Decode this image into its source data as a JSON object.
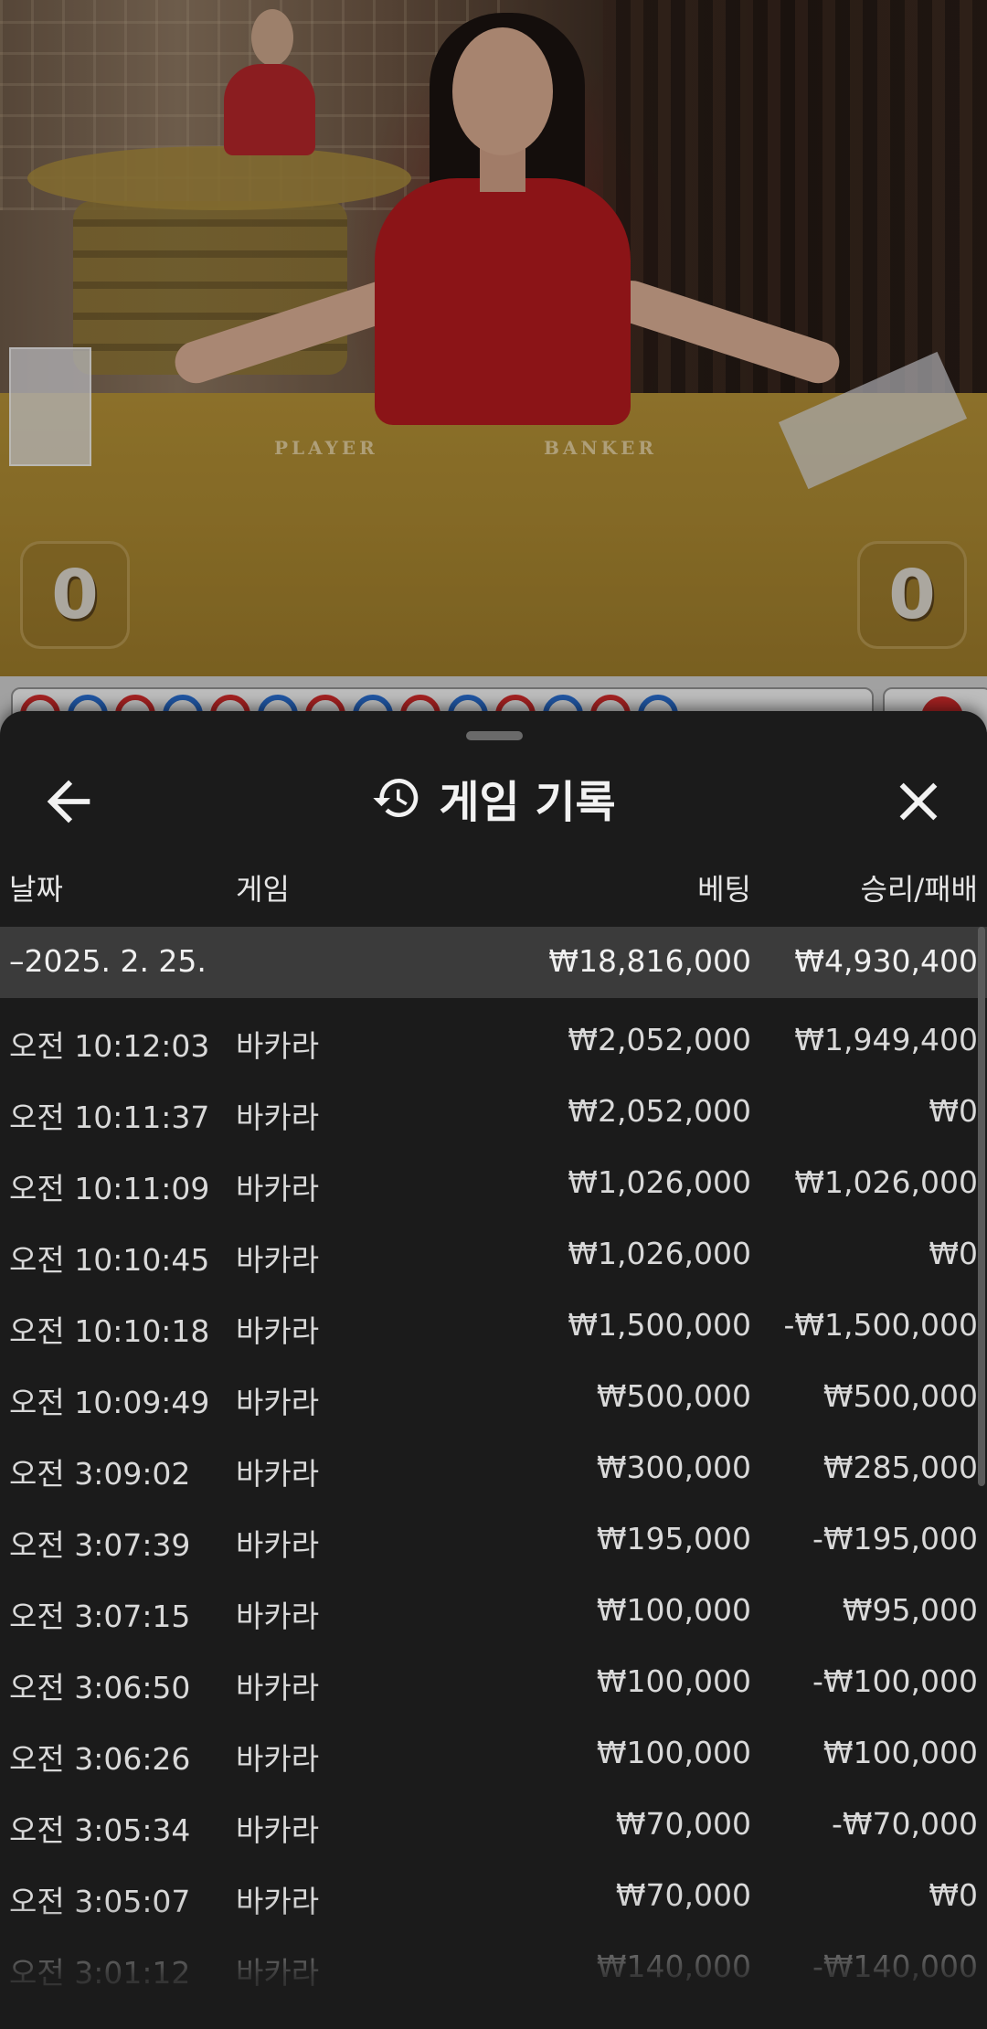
{
  "video": {
    "table_labels": {
      "player": "PLAYER",
      "banker": "BANKER"
    },
    "player_score": "0",
    "banker_score": "0",
    "roadmap": [
      "red",
      "blue",
      "red",
      "blue",
      "red",
      "blue",
      "red",
      "blue",
      "red",
      "blue",
      "red",
      "blue",
      "red",
      "blue"
    ]
  },
  "sheet": {
    "title": "게임 기록",
    "icons": {
      "back": "arrow-left-icon",
      "history": "history-icon",
      "close": "close-icon"
    },
    "columns": {
      "date": "날짜",
      "game": "게임",
      "bet": "베팅",
      "result": "승리/패배"
    },
    "date_group": {
      "date": "–2025. 2. 25.",
      "bet_total": "₩18,816,000",
      "result_total": "₩4,930,400"
    },
    "rows": [
      {
        "time": "오전 10:12:03",
        "game": "바카라",
        "bet": "₩2,052,000",
        "result": "₩1,949,400"
      },
      {
        "time": "오전 10:11:37",
        "game": "바카라",
        "bet": "₩2,052,000",
        "result": "₩0"
      },
      {
        "time": "오전 10:11:09",
        "game": "바카라",
        "bet": "₩1,026,000",
        "result": "₩1,026,000"
      },
      {
        "time": "오전 10:10:45",
        "game": "바카라",
        "bet": "₩1,026,000",
        "result": "₩0"
      },
      {
        "time": "오전 10:10:18",
        "game": "바카라",
        "bet": "₩1,500,000",
        "result": "-₩1,500,000"
      },
      {
        "time": "오전 10:09:49",
        "game": "바카라",
        "bet": "₩500,000",
        "result": "₩500,000"
      },
      {
        "time": "오전 3:09:02",
        "game": "바카라",
        "bet": "₩300,000",
        "result": "₩285,000"
      },
      {
        "time": "오전 3:07:39",
        "game": "바카라",
        "bet": "₩195,000",
        "result": "-₩195,000"
      },
      {
        "time": "오전 3:07:15",
        "game": "바카라",
        "bet": "₩100,000",
        "result": "₩95,000"
      },
      {
        "time": "오전 3:06:50",
        "game": "바카라",
        "bet": "₩100,000",
        "result": "-₩100,000"
      },
      {
        "time": "오전 3:06:26",
        "game": "바카라",
        "bet": "₩100,000",
        "result": "₩100,000"
      },
      {
        "time": "오전 3:05:34",
        "game": "바카라",
        "bet": "₩70,000",
        "result": "-₩70,000"
      },
      {
        "time": "오전 3:05:07",
        "game": "바카라",
        "bet": "₩70,000",
        "result": "₩0"
      },
      {
        "time": "오전 3:01:12",
        "game": "바카라",
        "bet": "₩140,000",
        "result": "-₩140,000"
      }
    ]
  }
}
